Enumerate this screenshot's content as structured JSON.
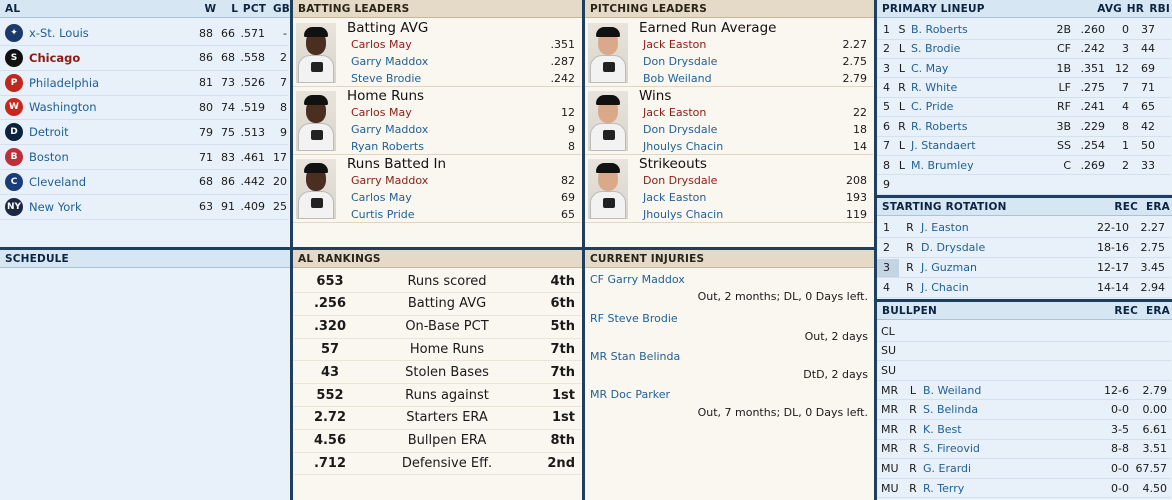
{
  "standings": {
    "title": "AL",
    "headers": {
      "w": "W",
      "l": "L",
      "pct": "PCT",
      "gb": "GB"
    },
    "teams": [
      {
        "name": "x-St. Louis",
        "w": "88",
        "l": "66",
        "pct": ".571",
        "gb": "-",
        "logo": "cardinals-logo",
        "color": "#1b3a6b",
        "glyph": "✦"
      },
      {
        "name": "Chicago",
        "w": "86",
        "l": "68",
        "pct": ".558",
        "gb": "2",
        "logo": "white-sox-logo",
        "color": "#111111",
        "glyph": "S",
        "highlight": true
      },
      {
        "name": "Philadelphia",
        "w": "81",
        "l": "73",
        "pct": ".526",
        "gb": "7",
        "logo": "phillies-logo",
        "color": "#c0281f",
        "glyph": "P"
      },
      {
        "name": "Washington",
        "w": "80",
        "l": "74",
        "pct": ".519",
        "gb": "8",
        "logo": "senators-logo",
        "color": "#c8281c",
        "glyph": "W"
      },
      {
        "name": "Detroit",
        "w": "79",
        "l": "75",
        "pct": ".513",
        "gb": "9",
        "logo": "tigers-logo",
        "color": "#0c2340",
        "glyph": "D"
      },
      {
        "name": "Boston",
        "w": "71",
        "l": "83",
        "pct": ".461",
        "gb": "17",
        "logo": "red-sox-logo",
        "color": "#bd3039",
        "glyph": "B"
      },
      {
        "name": "Cleveland",
        "w": "68",
        "l": "86",
        "pct": ".442",
        "gb": "20",
        "logo": "indians-logo",
        "color": "#1a3c7a",
        "glyph": "C"
      },
      {
        "name": "New York",
        "w": "63",
        "l": "91",
        "pct": ".409",
        "gb": "25",
        "logo": "yankees-logo",
        "color": "#1c2841",
        "glyph": "NY"
      }
    ]
  },
  "batting_leaders": {
    "title": "BATTING LEADERS",
    "blocks": [
      {
        "title": "Batting AVG",
        "rows": [
          {
            "name": "Carlos May",
            "value": ".351",
            "highlight": true
          },
          {
            "name": "Garry Maddox",
            "value": ".287"
          },
          {
            "name": "Steve Brodie",
            "value": ".242"
          }
        ]
      },
      {
        "title": "Home Runs",
        "rows": [
          {
            "name": "Carlos May",
            "value": "12",
            "highlight": true
          },
          {
            "name": "Garry Maddox",
            "value": "9"
          },
          {
            "name": "Ryan Roberts",
            "value": "8"
          }
        ]
      },
      {
        "title": "Runs Batted In",
        "rows": [
          {
            "name": "Garry Maddox",
            "value": "82",
            "highlight": true
          },
          {
            "name": "Carlos May",
            "value": "69"
          },
          {
            "name": "Curtis Pride",
            "value": "65"
          }
        ]
      }
    ]
  },
  "pitching_leaders": {
    "title": "PITCHING LEADERS",
    "blocks": [
      {
        "title": "Earned Run Average",
        "rows": [
          {
            "name": "Jack Easton",
            "value": "2.27",
            "highlight": true
          },
          {
            "name": "Don Drysdale",
            "value": "2.75"
          },
          {
            "name": "Bob Weiland",
            "value": "2.79"
          }
        ]
      },
      {
        "title": "Wins",
        "rows": [
          {
            "name": "Jack Easton",
            "value": "22",
            "highlight": true
          },
          {
            "name": "Don Drysdale",
            "value": "18"
          },
          {
            "name": "Jhoulys Chacin",
            "value": "14"
          }
        ]
      },
      {
        "title": "Strikeouts",
        "rows": [
          {
            "name": "Don Drysdale",
            "value": "208",
            "highlight": true
          },
          {
            "name": "Jack Easton",
            "value": "193"
          },
          {
            "name": "Jhoulys Chacin",
            "value": "119"
          }
        ]
      }
    ]
  },
  "lineup": {
    "title": "PRIMARY LINEUP",
    "headers": {
      "avg": "AVG",
      "hr": "HR",
      "rbi": "RBI"
    },
    "rows": [
      {
        "n": "1",
        "hand": "S",
        "name": "B. Roberts",
        "pos": "2B",
        "avg": ".260",
        "hr": "0",
        "rbi": "37"
      },
      {
        "n": "2",
        "hand": "L",
        "name": "S. Brodie",
        "pos": "CF",
        "avg": ".242",
        "hr": "3",
        "rbi": "44"
      },
      {
        "n": "3",
        "hand": "L",
        "name": "C. May",
        "pos": "1B",
        "avg": ".351",
        "hr": "12",
        "rbi": "69"
      },
      {
        "n": "4",
        "hand": "R",
        "name": "R. White",
        "pos": "LF",
        "avg": ".275",
        "hr": "7",
        "rbi": "71"
      },
      {
        "n": "5",
        "hand": "L",
        "name": "C. Pride",
        "pos": "RF",
        "avg": ".241",
        "hr": "4",
        "rbi": "65"
      },
      {
        "n": "6",
        "hand": "R",
        "name": "R. Roberts",
        "pos": "3B",
        "avg": ".229",
        "hr": "8",
        "rbi": "42"
      },
      {
        "n": "7",
        "hand": "L",
        "name": "J. Standaert",
        "pos": "SS",
        "avg": ".254",
        "hr": "1",
        "rbi": "50"
      },
      {
        "n": "8",
        "hand": "L",
        "name": "M. Brumley",
        "pos": "C",
        "avg": ".269",
        "hr": "2",
        "rbi": "33"
      },
      {
        "n": "9",
        "hand": "",
        "name": "",
        "pos": "",
        "avg": "",
        "hr": "",
        "rbi": ""
      }
    ]
  },
  "rotation": {
    "title": "STARTING ROTATION",
    "headers": {
      "rec": "REC",
      "era": "ERA"
    },
    "rows": [
      {
        "n": "1",
        "hand": "R",
        "name": "J. Easton",
        "rec": "22-10",
        "era": "2.27"
      },
      {
        "n": "2",
        "hand": "R",
        "name": "D. Drysdale",
        "rec": "18-16",
        "era": "2.75"
      },
      {
        "n": "3",
        "hand": "R",
        "name": "J. Guzman",
        "rec": "12-17",
        "era": "3.45",
        "selected": true
      },
      {
        "n": "4",
        "hand": "R",
        "name": "J. Chacin",
        "rec": "14-14",
        "era": "2.94"
      }
    ]
  },
  "bullpen": {
    "title": "BULLPEN",
    "headers": {
      "rec": "REC",
      "era": "ERA"
    },
    "rows": [
      {
        "role": "CL",
        "hand": "",
        "name": "",
        "rec": "",
        "era": ""
      },
      {
        "role": "SU",
        "hand": "",
        "name": "",
        "rec": "",
        "era": ""
      },
      {
        "role": "SU",
        "hand": "",
        "name": "",
        "rec": "",
        "era": ""
      },
      {
        "role": "MR",
        "hand": "L",
        "name": "B. Weiland",
        "rec": "12-6",
        "era": "2.79"
      },
      {
        "role": "MR",
        "hand": "R",
        "name": "S. Belinda",
        "rec": "0-0",
        "era": "0.00"
      },
      {
        "role": "MR",
        "hand": "R",
        "name": "K. Best",
        "rec": "3-5",
        "era": "6.61"
      },
      {
        "role": "MR",
        "hand": "R",
        "name": "S. Fireovid",
        "rec": "8-8",
        "era": "3.51"
      },
      {
        "role": "MU",
        "hand": "R",
        "name": "G. Erardi",
        "rec": "0-0",
        "era": "67.57"
      },
      {
        "role": "MU",
        "hand": "R",
        "name": "R. Terry",
        "rec": "0-0",
        "era": "4.50"
      }
    ]
  },
  "schedule": {
    "title": "SCHEDULE"
  },
  "rankings": {
    "title": "AL RANKINGS",
    "rows": [
      {
        "value": "653",
        "stat": "Runs scored",
        "rank": "4th"
      },
      {
        "value": ".256",
        "stat": "Batting AVG",
        "rank": "6th"
      },
      {
        "value": ".320",
        "stat": "On-Base PCT",
        "rank": "5th"
      },
      {
        "value": "57",
        "stat": "Home Runs",
        "rank": "7th"
      },
      {
        "value": "43",
        "stat": "Stolen Bases",
        "rank": "7th"
      },
      {
        "value": "552",
        "stat": "Runs against",
        "rank": "1st"
      },
      {
        "value": "2.72",
        "stat": "Starters ERA",
        "rank": "1st"
      },
      {
        "value": "4.56",
        "stat": "Bullpen ERA",
        "rank": "8th"
      },
      {
        "value": ".712",
        "stat": "Defensive Eff.",
        "rank": "2nd"
      }
    ]
  },
  "injuries": {
    "title": "CURRENT INJURIES",
    "rows": [
      {
        "name": "CF Garry Maddox",
        "status": "Out, 2 months; DL, 0 Days left."
      },
      {
        "name": "RF Steve Brodie",
        "status": "Out, 2 days"
      },
      {
        "name": "MR Stan Belinda",
        "status": "DtD, 2 days"
      },
      {
        "name": "MR Doc Parker",
        "status": "Out, 7 months; DL, 0 Days left."
      }
    ]
  },
  "colors": {
    "highlight_team": "#8b1c14",
    "link": "#1f5f95",
    "header_blue": "#d6e6f3",
    "header_tan": "#e4dac7"
  }
}
